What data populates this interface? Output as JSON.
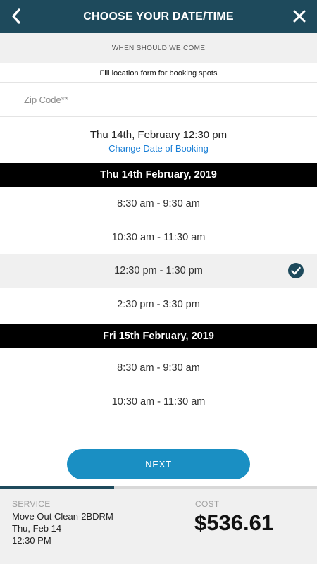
{
  "header": {
    "title": "CHOOSE YOUR DATE/TIME",
    "back_icon": "chevron-left-icon",
    "close_icon": "close-icon"
  },
  "subheader": "WHEN SHOULD WE COME",
  "fill_note": "Fill location form for booking spots",
  "zip": {
    "placeholder": "Zip Code**",
    "value": ""
  },
  "selection": {
    "datetime": "Thu 14th, February 12:30 pm",
    "change_link": "Change Date of Booking"
  },
  "days": [
    {
      "label": "Thu 14th February, 2019",
      "slots": [
        {
          "label": "8:30 am - 9:30 am",
          "selected": false
        },
        {
          "label": "10:30 am - 11:30 am",
          "selected": false
        },
        {
          "label": "12:30 pm - 1:30 pm",
          "selected": true
        },
        {
          "label": "2:30 pm - 3:30 pm",
          "selected": false
        }
      ]
    },
    {
      "label": "Fri 15th February, 2019",
      "slots": [
        {
          "label": "8:30 am - 9:30 am",
          "selected": false
        },
        {
          "label": "10:30 am - 11:30 am",
          "selected": false
        }
      ]
    }
  ],
  "next_button": "NEXT",
  "progress": 0.36,
  "footer": {
    "service_label": "SERVICE",
    "service_name": "Move Out Clean-2BDRM",
    "service_date": "Thu, Feb 14",
    "service_time": "12:30 PM",
    "cost_label": "COST",
    "cost_value": "$536.61"
  },
  "colors": {
    "header_bg": "#1e4a5c",
    "accent_button": "#1a8fc3",
    "link": "#1a7fd6",
    "date_band": "#000000",
    "check": "#1e4a5c"
  }
}
